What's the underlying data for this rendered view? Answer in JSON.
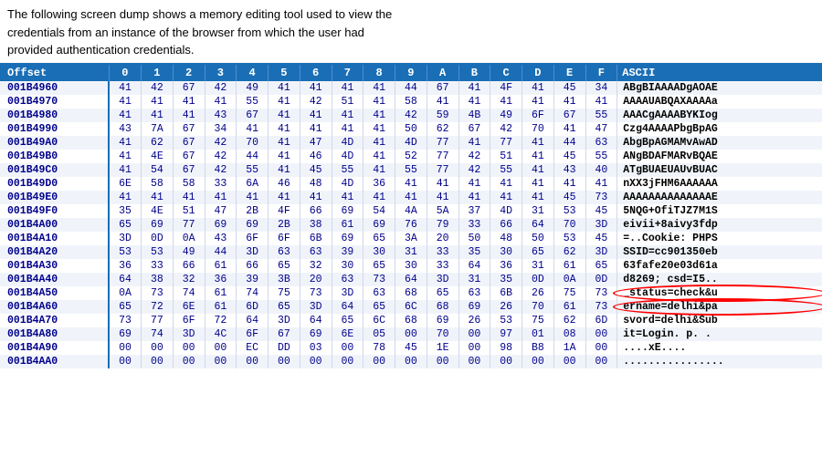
{
  "intro": {
    "line1": "The following screen dump shows  a memory editing tool used to view the",
    "line2": "credentials from an   instance of  the browser from which the user had",
    "line3": "provided authentication credentials."
  },
  "table": {
    "headers": [
      "Offset",
      "0",
      "1",
      "2",
      "3",
      "4",
      "5",
      "6",
      "7",
      "8",
      "9",
      "A",
      "B",
      "C",
      "D",
      "E",
      "F",
      "ASCII"
    ],
    "rows": [
      [
        "001B4960",
        "41",
        "42",
        "67",
        "42",
        "49",
        "41",
        "41",
        "41",
        "41",
        "44",
        "67",
        "41",
        "4F",
        "41",
        "45",
        "34",
        "ABgBIAAAADgAOAE"
      ],
      [
        "001B4970",
        "41",
        "41",
        "41",
        "41",
        "55",
        "41",
        "42",
        "51",
        "41",
        "58",
        "41",
        "41",
        "41",
        "41",
        "41",
        "41",
        "AAAAUABQAXAAAAa"
      ],
      [
        "001B4980",
        "41",
        "41",
        "41",
        "43",
        "67",
        "41",
        "41",
        "41",
        "41",
        "42",
        "59",
        "4B",
        "49",
        "6F",
        "67",
        "55",
        "AAACgAAAABYKIog"
      ],
      [
        "001B4990",
        "43",
        "7A",
        "67",
        "34",
        "41",
        "41",
        "41",
        "41",
        "41",
        "50",
        "62",
        "67",
        "42",
        "70",
        "41",
        "47",
        "Czg4AAAAPbgBpAG"
      ],
      [
        "001B49A0",
        "41",
        "62",
        "67",
        "42",
        "70",
        "41",
        "47",
        "4D",
        "41",
        "4D",
        "77",
        "41",
        "77",
        "41",
        "44",
        "63",
        "AbgBpAGMAMvAwAD"
      ],
      [
        "001B49B0",
        "41",
        "4E",
        "67",
        "42",
        "44",
        "41",
        "46",
        "4D",
        "41",
        "52",
        "77",
        "42",
        "51",
        "41",
        "45",
        "55",
        "ANgBDAFMARvBQAE"
      ],
      [
        "001B49C0",
        "41",
        "54",
        "67",
        "42",
        "55",
        "41",
        "45",
        "55",
        "41",
        "55",
        "77",
        "42",
        "55",
        "41",
        "43",
        "40",
        "ATgBUAEUAUvBUAC"
      ],
      [
        "001B49D0",
        "6E",
        "58",
        "58",
        "33",
        "6A",
        "46",
        "48",
        "4D",
        "36",
        "41",
        "41",
        "41",
        "41",
        "41",
        "41",
        "41",
        "nXX3jFHM6AAAAAA"
      ],
      [
        "001B49E0",
        "41",
        "41",
        "41",
        "41",
        "41",
        "41",
        "41",
        "41",
        "41",
        "41",
        "41",
        "41",
        "41",
        "41",
        "45",
        "73",
        "AAAAAAAAAAAAAAE"
      ],
      [
        "001B49F0",
        "35",
        "4E",
        "51",
        "47",
        "2B",
        "4F",
        "66",
        "69",
        "54",
        "4A",
        "5A",
        "37",
        "4D",
        "31",
        "53",
        "45",
        "5NQG+OfiTJZ7M1S"
      ],
      [
        "001B4A00",
        "65",
        "69",
        "77",
        "69",
        "69",
        "2B",
        "38",
        "61",
        "69",
        "76",
        "79",
        "33",
        "66",
        "64",
        "70",
        "3D",
        "eivii+8aivy3fdp"
      ],
      [
        "001B4A10",
        "3D",
        "0D",
        "0A",
        "43",
        "6F",
        "6F",
        "6B",
        "69",
        "65",
        "3A",
        "20",
        "50",
        "48",
        "50",
        "53",
        "45",
        "=..Cookie: PHPS"
      ],
      [
        "001B4A20",
        "53",
        "53",
        "49",
        "44",
        "3D",
        "63",
        "63",
        "39",
        "30",
        "31",
        "33",
        "35",
        "30",
        "65",
        "62",
        "3D",
        "SSID=cc901350eb"
      ],
      [
        "001B4A30",
        "36",
        "33",
        "66",
        "61",
        "66",
        "65",
        "32",
        "30",
        "65",
        "30",
        "33",
        "64",
        "36",
        "31",
        "61",
        "65",
        "63fafe20e03d61a"
      ],
      [
        "001B4A40",
        "64",
        "38",
        "32",
        "36",
        "39",
        "3B",
        "20",
        "63",
        "73",
        "64",
        "3D",
        "31",
        "35",
        "0D",
        "0A",
        "0D",
        "d8269; csd=I5.."
      ],
      [
        "001B4A50",
        "0A",
        "73",
        "74",
        "61",
        "74",
        "75",
        "73",
        "3D",
        "63",
        "68",
        "65",
        "63",
        "6B",
        "26",
        "75",
        "73",
        "_status=check&u"
      ],
      [
        "001B4A60",
        "65",
        "72",
        "6E",
        "61",
        "6D",
        "65",
        "3D",
        "64",
        "65",
        "6C",
        "68",
        "69",
        "26",
        "70",
        "61",
        "73",
        "ername=delhi&pa"
      ],
      [
        "001B4A70",
        "73",
        "77",
        "6F",
        "72",
        "64",
        "3D",
        "64",
        "65",
        "6C",
        "68",
        "69",
        "26",
        "53",
        "75",
        "62",
        "6D",
        "svord=delhi&Sub"
      ],
      [
        "001B4A80",
        "69",
        "74",
        "3D",
        "4C",
        "6F",
        "67",
        "69",
        "6E",
        "05",
        "00",
        "70",
        "00",
        "97",
        "01",
        "08",
        "00",
        "it=Login. p. ."
      ],
      [
        "001B4A90",
        "00",
        "00",
        "00",
        "00",
        "EC",
        "DD",
        "03",
        "00",
        "78",
        "45",
        "1E",
        "00",
        "98",
        "B8",
        "1A",
        "00",
        "....xE...."
      ],
      [
        "001B4AA0",
        "00",
        "00",
        "00",
        "00",
        "00",
        "00",
        "00",
        "00",
        "00",
        "00",
        "00",
        "00",
        "00",
        "00",
        "00",
        "00",
        "................"
      ]
    ]
  }
}
